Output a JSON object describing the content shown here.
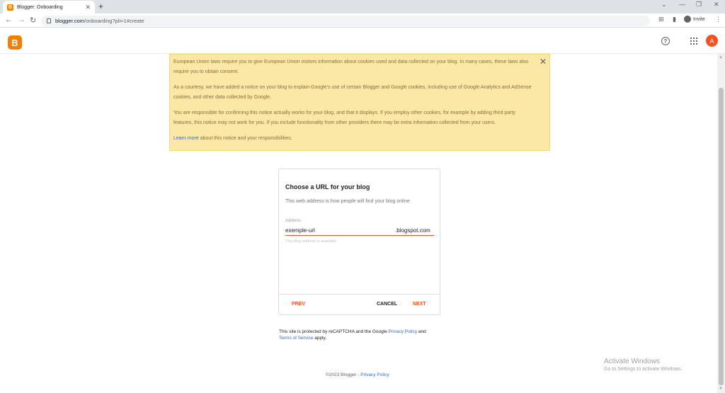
{
  "browser": {
    "tab_title": "Blogger: Onboarding",
    "tab_close": "✕",
    "new_tab": "+",
    "url_host": "blogger.com",
    "url_path": "/onboarding?pli=1#create",
    "invite_label": "Invite",
    "window_controls": [
      "⌄",
      "—",
      "❐",
      "✕"
    ]
  },
  "header": {
    "logo_letter": "B",
    "help_glyph": "?",
    "avatar_letter": "A"
  },
  "notice": {
    "para1": "European Union laws require you to give European Union visitors information about cookies used and data collected on your blog. In many cases, these laws also require you to obtain consent.",
    "para2": "As a courtesy, we have added a notice on your blog to explain Google's use of certain Blogger and Google cookies, including use of Google Analytics and AdSense cookies, and other data collected by Google.",
    "para3": "You are responsible for confirming this notice actually works for your blog, and that it displays. If you employ other cookies, for example by adding third party features, this notice may not work for you. If you include functionality from other providers there may be extra information collected from your users.",
    "learn_more": "Learn more",
    "learn_more_suffix": " about this notice and your responsibilities.",
    "close_glyph": "✕"
  },
  "card": {
    "title": "Choose a URL for your blog",
    "subtitle": "This web address is how people will find your blog online",
    "address_label": "Address",
    "address_value": "exemple-url",
    "address_suffix": ".blogspot.com",
    "address_help": "This blog address is available.",
    "prev_label": "PREV",
    "cancel_label": "CANCEL",
    "next_label": "NEXT"
  },
  "recaptcha": {
    "prefix": "This site is protected by reCAPTCHA and the Google ",
    "privacy": "Privacy Policy",
    "and": " and",
    "terms": "Terms of Service",
    "suffix": " apply."
  },
  "footer": {
    "copyright": "©2023 Blogger - ",
    "privacy": "Privacy Policy"
  },
  "watermark": {
    "title": "Activate Windows",
    "subtitle": "Go to Settings to activate Windows."
  },
  "colors": {
    "brand": "#f57d00",
    "accent": "#f4511e",
    "link": "#3367d6",
    "notice_bg": "#fce8a6"
  }
}
